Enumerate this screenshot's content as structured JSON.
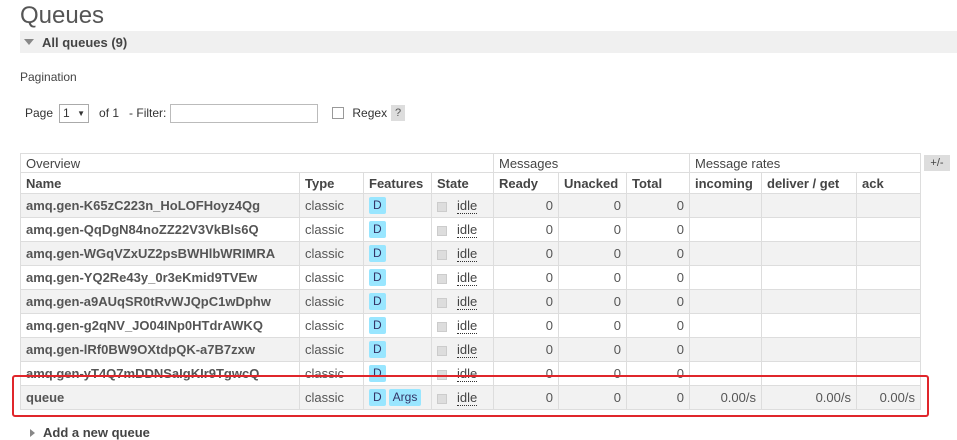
{
  "page_title": "Queues",
  "section": {
    "label": "All queues (9)"
  },
  "pagination": {
    "label": "Pagination",
    "page_label": "Page",
    "page_value": "1",
    "of_label": "of 1",
    "filter_label": "- Filter:",
    "filter_value": "",
    "regex_label": "Regex",
    "help_label": "?"
  },
  "table": {
    "groups": [
      "Overview",
      "Messages",
      "Message rates"
    ],
    "columns": [
      "Name",
      "Type",
      "Features",
      "State",
      "Ready",
      "Unacked",
      "Total",
      "incoming",
      "deliver / get",
      "ack"
    ],
    "plusminus": "+/-",
    "rows": [
      {
        "name": "amq.gen-K65zC223n_HoLOFHoyz4Qg",
        "type": "classic",
        "features": [
          "D"
        ],
        "state": "idle",
        "ready": "0",
        "unacked": "0",
        "total": "0",
        "incoming": "",
        "deliver": "",
        "ack": ""
      },
      {
        "name": "amq.gen-QqDgN84noZZ22V3VkBls6Q",
        "type": "classic",
        "features": [
          "D"
        ],
        "state": "idle",
        "ready": "0",
        "unacked": "0",
        "total": "0",
        "incoming": "",
        "deliver": "",
        "ack": ""
      },
      {
        "name": "amq.gen-WGqVZxUZ2psBWHlbWRIMRA",
        "type": "classic",
        "features": [
          "D"
        ],
        "state": "idle",
        "ready": "0",
        "unacked": "0",
        "total": "0",
        "incoming": "",
        "deliver": "",
        "ack": ""
      },
      {
        "name": "amq.gen-YQ2Re43y_0r3eKmid9TVEw",
        "type": "classic",
        "features": [
          "D"
        ],
        "state": "idle",
        "ready": "0",
        "unacked": "0",
        "total": "0",
        "incoming": "",
        "deliver": "",
        "ack": ""
      },
      {
        "name": "amq.gen-a9AUqSR0tRvWJQpC1wDphw",
        "type": "classic",
        "features": [
          "D"
        ],
        "state": "idle",
        "ready": "0",
        "unacked": "0",
        "total": "0",
        "incoming": "",
        "deliver": "",
        "ack": ""
      },
      {
        "name": "amq.gen-g2qNV_JO04INp0HTdrAWKQ",
        "type": "classic",
        "features": [
          "D"
        ],
        "state": "idle",
        "ready": "0",
        "unacked": "0",
        "total": "0",
        "incoming": "",
        "deliver": "",
        "ack": ""
      },
      {
        "name": "amq.gen-lRf0BW9OXtdpQK-a7B7zxw",
        "type": "classic",
        "features": [
          "D"
        ],
        "state": "idle",
        "ready": "0",
        "unacked": "0",
        "total": "0",
        "incoming": "",
        "deliver": "",
        "ack": ""
      },
      {
        "name": "amq.gen-yT4Q7mDDNSaIgKIr9TgwcQ",
        "type": "classic",
        "features": [
          "D"
        ],
        "state": "idle",
        "ready": "0",
        "unacked": "0",
        "total": "0",
        "incoming": "",
        "deliver": "",
        "ack": ""
      },
      {
        "name": "queue",
        "type": "classic",
        "features": [
          "D",
          "Args"
        ],
        "state": "idle",
        "ready": "0",
        "unacked": "0",
        "total": "0",
        "incoming": "0.00/s",
        "deliver": "0.00/s",
        "ack": "0.00/s"
      }
    ]
  },
  "add_queue_label": "Add a new queue",
  "colors": {
    "highlight": "#e0262b",
    "tag_bg": "#99e6ff"
  }
}
